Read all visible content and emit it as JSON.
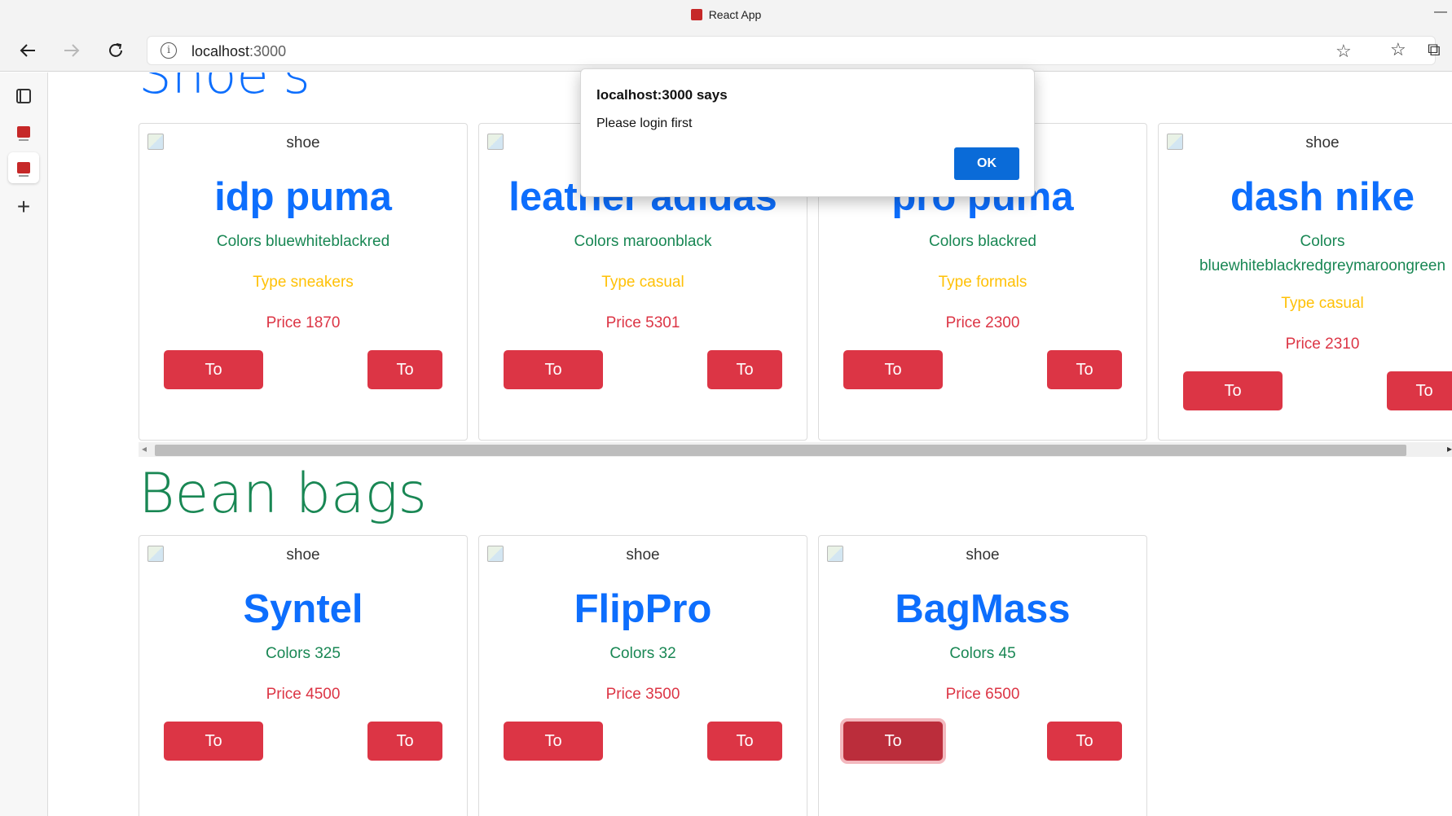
{
  "browser": {
    "window_title": "React App",
    "url_host": "localhost",
    "url_port": ":3000"
  },
  "shoes_section": {
    "title": "Shoe's",
    "cards": [
      {
        "img_alt": "shoe",
        "name": "idp puma",
        "colors": "Colors bluewhiteblackred",
        "type": "Type sneakers",
        "price": "Price 1870",
        "wishlist": "To wishlist",
        "kart": "To kart"
      },
      {
        "img_alt": "shoe",
        "name": "leather adidas",
        "colors": "Colors maroonblack",
        "type": "Type casual",
        "price": "Price 5301",
        "wishlist": "To wishlist",
        "kart": "To kart"
      },
      {
        "img_alt": "shoe",
        "name": "pro puma",
        "colors": "Colors blackred",
        "type": "Type formals",
        "price": "Price 2300",
        "wishlist": "To wishlist",
        "kart": "To kart"
      },
      {
        "img_alt": "shoe",
        "name": "dash nike",
        "colors_label": "Colors",
        "colors_value": "bluewhiteblackredgreymaroongreen",
        "type": "Type casual",
        "price": "Price 2310",
        "wishlist": "To wishlist",
        "kart": "To kart"
      }
    ]
  },
  "beanbags_section": {
    "title": "Bean bags",
    "cards": [
      {
        "img_alt": "shoe",
        "name": "Syntel",
        "colors": "Colors 325",
        "price": "Price 4500",
        "wishlist": "To wishlist",
        "kart": "To kart"
      },
      {
        "img_alt": "shoe",
        "name": "FlipPro",
        "colors": "Colors 32",
        "price": "Price 3500",
        "wishlist": "To wishlist",
        "kart": "To kart"
      },
      {
        "img_alt": "shoe",
        "name": "BagMass",
        "colors": "Colors 45",
        "price": "Price 6500",
        "wishlist": "To wishlist",
        "kart": "To kart"
      }
    ]
  },
  "alert": {
    "title": "localhost:3000 says",
    "message": "Please login first",
    "ok_label": "OK"
  },
  "colors": {
    "primary": "#0d6efd",
    "success": "#198754",
    "warning": "#ffc107",
    "danger": "#dc3545",
    "dialog_ok": "#0a6bd8"
  }
}
